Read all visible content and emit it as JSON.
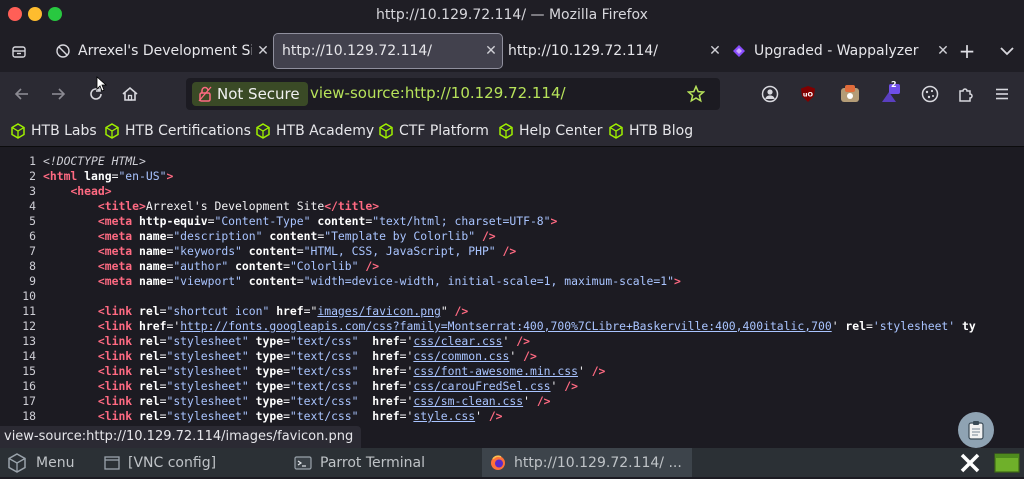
{
  "window": {
    "title": "http://10.129.72.114/ — Mozilla Firefox"
  },
  "tabs": [
    {
      "label": "Arrexel's Development Si",
      "active": false,
      "icon": "blocked-icon"
    },
    {
      "label": "http://10.129.72.114/",
      "active": true
    },
    {
      "label": "http://10.129.72.114/",
      "active": false
    },
    {
      "label": "Upgraded - Wappalyzer",
      "active": false,
      "icon": "wappalyzer-icon"
    }
  ],
  "nav": {
    "security_label": "Not Secure",
    "url": "view-source:http://10.129.72.114/",
    "extension_badge": "2"
  },
  "bookmarks": [
    "HTB Labs",
    "HTB Certifications",
    "HTB Academy",
    "CTF Platform",
    "Help Center",
    "HTB Blog"
  ],
  "source_lines": {
    "n1": "1",
    "n2": "2",
    "n3": "3",
    "n4": "4",
    "n5": "5",
    "n6": "6",
    "n7": "7",
    "n8": "8",
    "n9": "9",
    "n10": "10",
    "n11": "11",
    "n12": "12",
    "n13": "13",
    "n14": "14",
    "n15": "15",
    "n16": "16",
    "n17": "17",
    "n18": "18",
    "l1_doctype": "<!DOCTYPE HTML>",
    "html_tag": "html",
    "lang_attr": "lang",
    "lang_val": "\"en-US\"",
    "head_tag": "head",
    "title_open": "<title>",
    "title_text": "Arrexel's Development Site",
    "title_close": "</title>",
    "meta_tag": "meta",
    "http_equiv": "http-equiv",
    "content_type_val": "\"Content-Type\"",
    "content_attr": "content",
    "charset_val": "\"text/html; charset=UTF-8\"",
    "name_attr": "name",
    "desc_val": "\"description\"",
    "desc_content": "\"Template by Colorlib\"",
    "kw_val": "\"keywords\"",
    "kw_content": "\"HTML, CSS, JavaScript, PHP\"",
    "author_val": "\"author\"",
    "author_content": "\"Colorlib\"",
    "viewport_val": "\"viewport\"",
    "viewport_content": "\"width=device-width, initial-scale=1, maximum-scale=1\"",
    "link_tag": "link",
    "rel_attr": "rel",
    "href_attr": "href",
    "type_attr": "type",
    "shortcut_val": "\"shortcut icon\"",
    "favicon_href": "images/favicon.png",
    "fonts_href": "http://fonts.googleapis.com/css?family=Montserrat:400,700%7CLibre+Baskerville:400,400italic,700",
    "stylesheet_sq": "'stylesheet'",
    "ty_trunc": "ty",
    "stylesheet_dq": "\"stylesheet\"",
    "textcss": "\"text/css\"",
    "css1": "css/clear.css",
    "css2": "css/common.css",
    "css3": "css/font-awesome.min.css",
    "css4": "css/carouFredSel.css",
    "css5": "css/sm-clean.css",
    "css6": "style.css"
  },
  "status_text": "view-source:http://10.129.72.114/images/favicon.png",
  "panel": {
    "menu": "Menu",
    "vnc": "[VNC config]",
    "terminal": "Parrot Terminal",
    "firefox": "http://10.129.72.114/ ..."
  },
  "colors": {
    "accent_green": "#b7e35a",
    "tag_pink": "#ff6a82",
    "value_blue": "#a9c4ff",
    "not_secure_bg": "#3a4a26"
  }
}
